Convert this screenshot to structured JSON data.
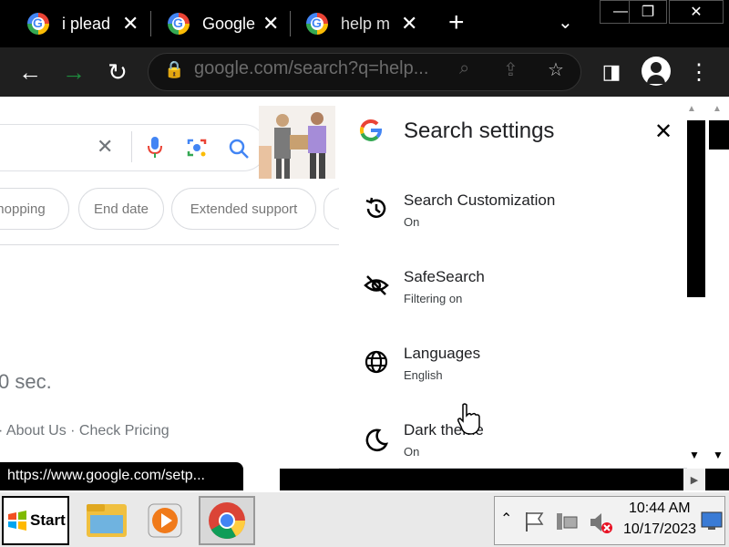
{
  "tabs": [
    {
      "title": "i plead"
    },
    {
      "title": "Google"
    },
    {
      "title": "help m"
    }
  ],
  "omnibox": {
    "url": "google.com/search?q=help..."
  },
  "page": {
    "chips": [
      "Shopping",
      "End date",
      "Extended support"
    ],
    "results_text": "0 sec.",
    "footer_links": "· About Us · Check Pricing"
  },
  "settings_panel": {
    "title": "Search settings",
    "items": [
      {
        "name": "Search Customization",
        "status": "On",
        "icon": "history-icon"
      },
      {
        "name": "SafeSearch",
        "status": "Filtering on",
        "icon": "eye-off-icon"
      },
      {
        "name": "Languages",
        "status": "English",
        "icon": "globe-icon"
      },
      {
        "name": "Dark theme",
        "status": "On",
        "icon": "moon-icon"
      }
    ]
  },
  "status_url": "https://www.google.com/setp...",
  "taskbar": {
    "start_label": "Start",
    "time": "10:44 AM",
    "date": "10/17/2023"
  },
  "colors": {
    "google_blue": "#4285f4",
    "google_red": "#ea4335",
    "google_yellow": "#fbbc05",
    "google_green": "#34a853",
    "forward_arrow": "#1e8e3e"
  }
}
